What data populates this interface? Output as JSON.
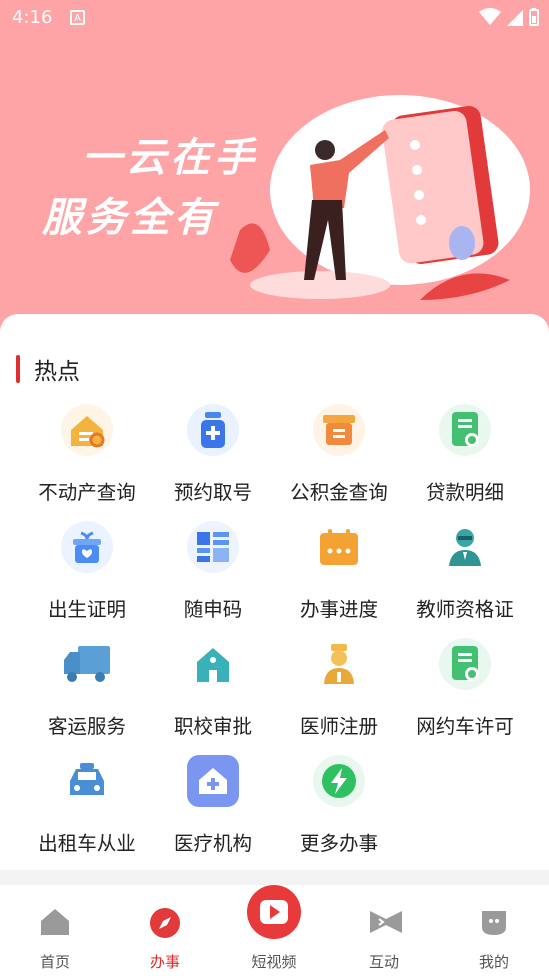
{
  "status_bar": {
    "time": "4:16",
    "notify_letter": "A"
  },
  "banner": {
    "line1": "一云在手",
    "line2": "服务全有",
    "bg_color": "#ffa4a6"
  },
  "section": {
    "title": "热点",
    "accent_color": "#e02e2e"
  },
  "services": [
    {
      "label": "不动产查询",
      "icon": "house-search-icon"
    },
    {
      "label": "预约取号",
      "icon": "medicine-bottle-icon"
    },
    {
      "label": "公积金查询",
      "icon": "fund-box-icon"
    },
    {
      "label": "贷款明细",
      "icon": "document-badge-icon"
    },
    {
      "label": "出生证明",
      "icon": "gift-heart-icon"
    },
    {
      "label": "随申码",
      "icon": "code-grid-icon"
    },
    {
      "label": "办事进度",
      "icon": "calendar-icon"
    },
    {
      "label": "教师资格证",
      "icon": "teacher-icon"
    },
    {
      "label": "客运服务",
      "icon": "truck-icon"
    },
    {
      "label": "职校审批",
      "icon": "school-building-icon"
    },
    {
      "label": "医师注册",
      "icon": "doctor-icon"
    },
    {
      "label": "网约车许可",
      "icon": "license-document-icon"
    },
    {
      "label": "出租车从业",
      "icon": "taxi-icon"
    },
    {
      "label": "医疗机构",
      "icon": "hospital-icon"
    },
    {
      "label": "更多办事",
      "icon": "lightning-icon"
    }
  ],
  "tabs": [
    {
      "label": "首页",
      "icon": "home-icon"
    },
    {
      "label": "办事",
      "icon": "compass-icon",
      "active": true
    },
    {
      "label": "短视频",
      "icon": "play-icon"
    },
    {
      "label": "互动",
      "icon": "interact-icon"
    },
    {
      "label": "我的",
      "icon": "profile-icon"
    }
  ]
}
